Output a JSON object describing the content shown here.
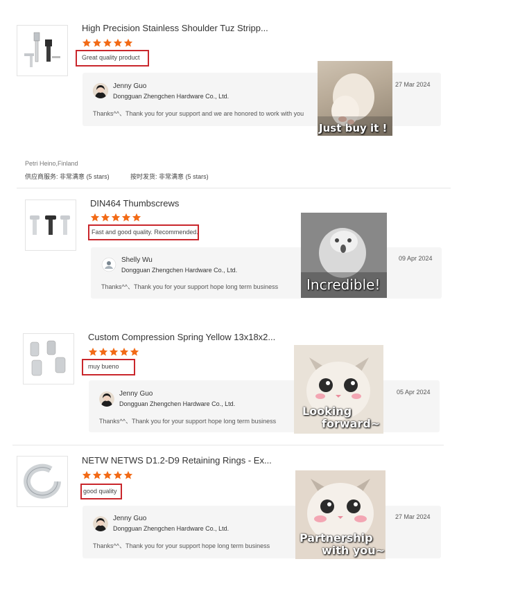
{
  "reviews": [
    {
      "title": "High Precision Stainless Shoulder Tuz Stripp...",
      "comment": "Great quality product",
      "reply": {
        "name": "Jenny Guo",
        "company": "Dongguan Zhengchen Hardware Co., Ltd.",
        "message": "Thanks^^、Thank you for your support and we are honored to work with you",
        "date": "27 Mar 2024"
      },
      "meme_caption": "Just buy it !"
    },
    {
      "title": "DIN464 Thumbscrews",
      "comment": "Fast and good quality. Recommended.",
      "reply": {
        "name": "Shelly Wu",
        "company": "Dongguan Zhengchen Hardware Co., Ltd.",
        "message": "Thanks^^、Thank you for your support  hope long term business",
        "date": "09 Apr 2024"
      },
      "meme_caption": "Incredible!"
    },
    {
      "title": "Custom Compression Spring Yellow 13x18x2...",
      "comment": "muy bueno",
      "reply": {
        "name": "Jenny Guo",
        "company": "Dongguan Zhengchen Hardware Co., Ltd.",
        "message": "Thanks^^、Thank you for your support  hope long term business",
        "date": "05 Apr 2024"
      },
      "meme_caption_line1": "Looking",
      "meme_caption_line2": "forward~"
    },
    {
      "title": "NETW NETWS D1.2-D9 Retaining Rings - Ex...",
      "comment": "good quality",
      "reply": {
        "name": "Jenny Guo",
        "company": "Dongguan Zhengchen Hardware Co., Ltd.",
        "message": "Thanks^^、Thank you for your support  hope long term business",
        "date": "27 Mar 2024"
      },
      "meme_caption_line1": "Partnership",
      "meme_caption_line2": "with you~"
    }
  ],
  "reviewer": {
    "name": "Petri Heino,Finland",
    "supplier_service_label": "供应商服务:",
    "supplier_service_value": "非常满意",
    "supplier_service_stars": "(5 stars)",
    "ontime_label": "按时发货:",
    "ontime_value": "非常满意",
    "ontime_stars": "(5 stars)"
  },
  "rating": {
    "stars": 5,
    "max": 5
  },
  "colors": {
    "star": "#f26a16",
    "highlight_border": "#c9262b",
    "reply_bg": "#f5f5f5"
  },
  "icons": [
    "star-icon",
    "avatar-icon"
  ]
}
